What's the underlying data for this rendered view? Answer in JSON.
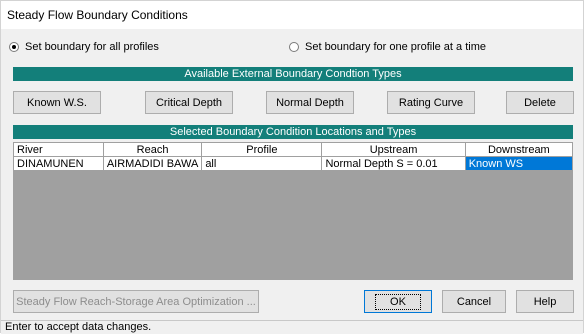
{
  "window": {
    "title": "Steady Flow Boundary Conditions"
  },
  "options": {
    "all_profiles": "Set boundary for all profiles",
    "one_profile": "Set boundary for one profile at a time",
    "selected": "all_profiles"
  },
  "available": {
    "header": "Available External Boundary Condtion Types",
    "buttons": {
      "known_ws": "Known W.S.",
      "critical_depth": "Critical Depth",
      "normal_depth": "Normal Depth",
      "rating_curve": "Rating Curve",
      "delete": "Delete"
    }
  },
  "selected_section": {
    "header": "Selected Boundary Condition Locations and Types",
    "columns": [
      "River",
      "Reach",
      "Profile",
      "Upstream",
      "Downstream"
    ],
    "rows": [
      {
        "river": "DINAMUNEN",
        "reach": "AIRMADIDI BAWA",
        "profile": "all",
        "upstream": "Normal Depth S = 0.01",
        "downstream": "Known WS"
      }
    ]
  },
  "footer": {
    "optimization": "Steady Flow Reach-Storage Area Optimization ...",
    "ok": "OK",
    "cancel": "Cancel",
    "help": "Help"
  },
  "status": "Enter to accept data changes."
}
